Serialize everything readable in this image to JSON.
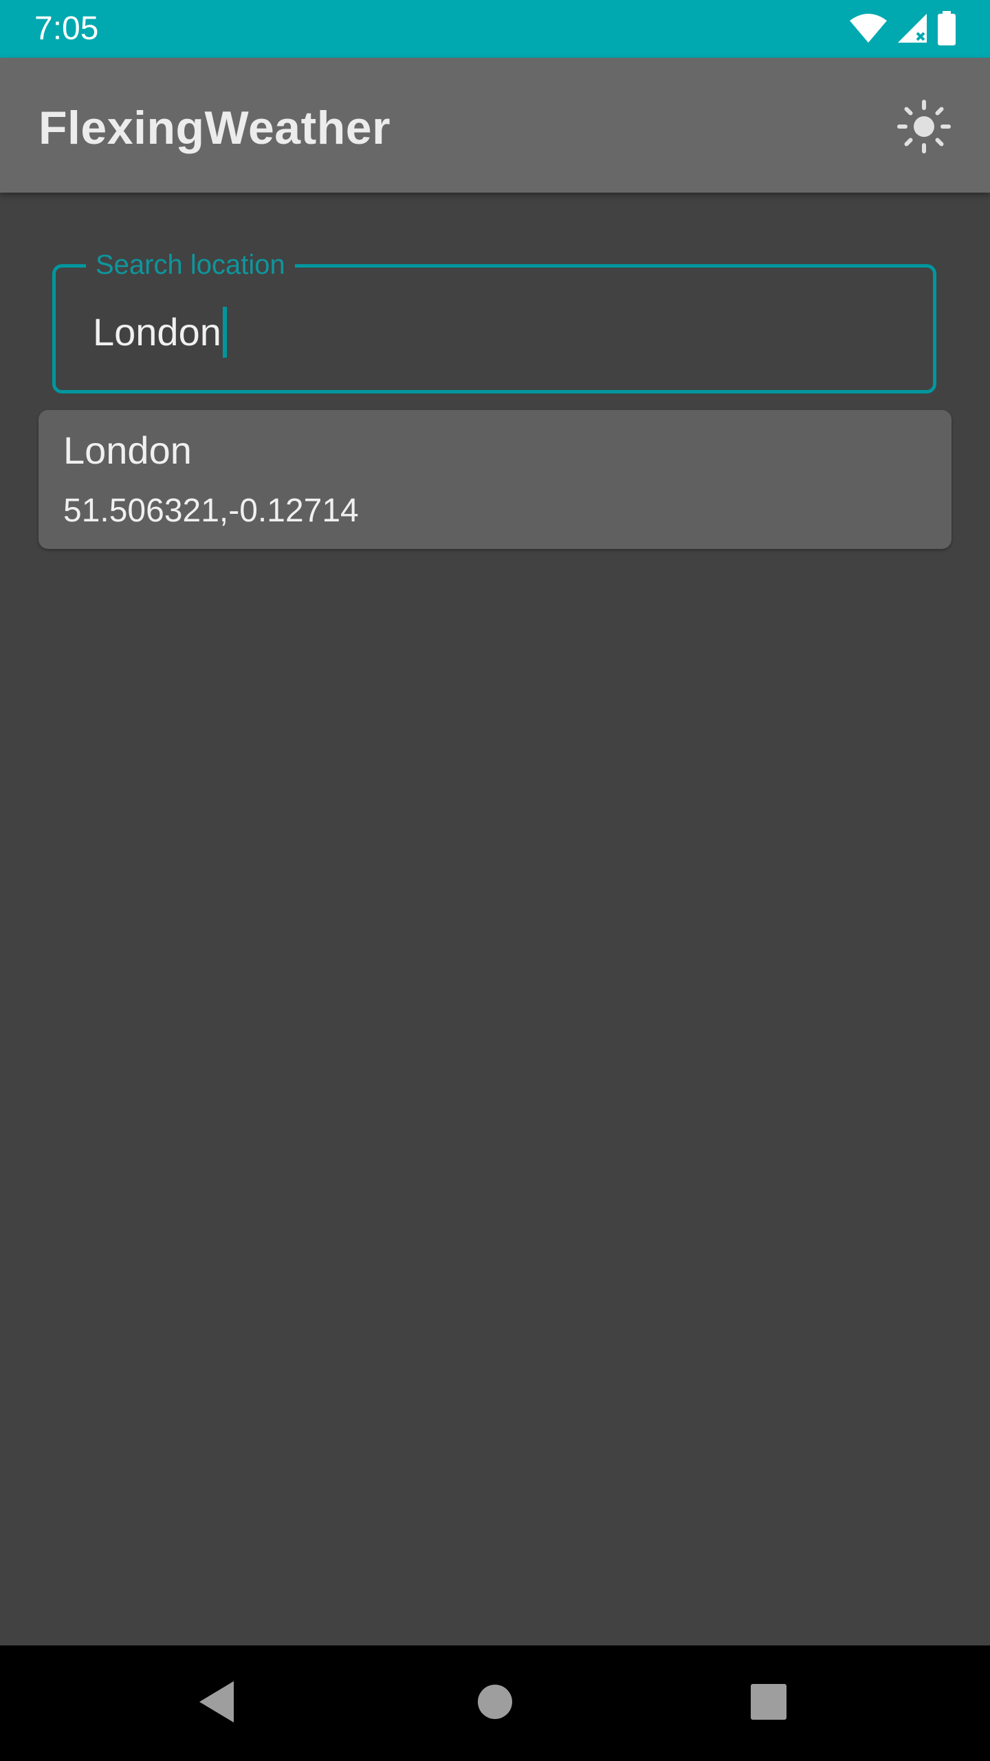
{
  "status_bar": {
    "time": "7:05",
    "icons": [
      "wifi-icon",
      "cell-signal-icon",
      "battery-icon"
    ]
  },
  "app_bar": {
    "title": "FlexingWeather",
    "action_icon": "sun-icon"
  },
  "search": {
    "label": "Search location",
    "value": "London"
  },
  "results": [
    {
      "name": "London",
      "coordinates": "51.506321,-0.12714"
    }
  ],
  "nav_bar": {
    "icons": [
      "back-icon",
      "home-icon",
      "recents-icon"
    ]
  },
  "colors": {
    "status_bar": "#00a8b0",
    "app_bar": "#686868",
    "background": "#424242",
    "accent": "#00969e",
    "card": "#606060"
  }
}
